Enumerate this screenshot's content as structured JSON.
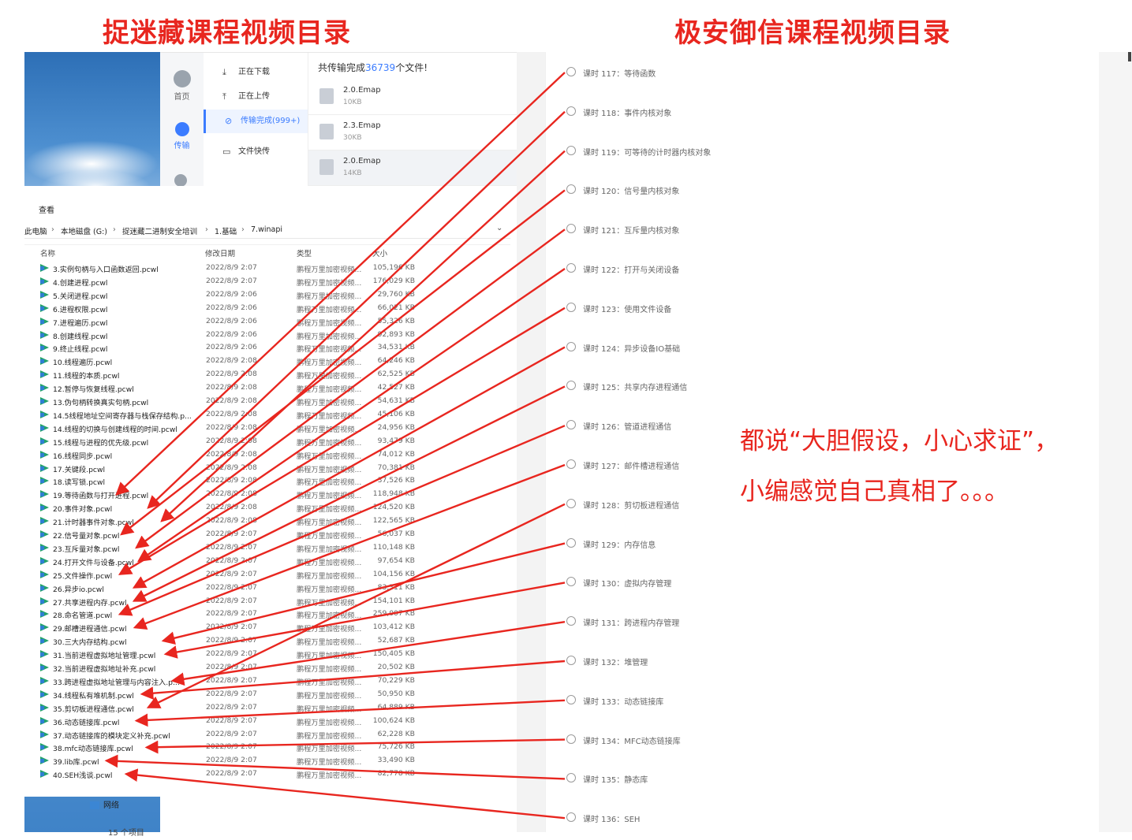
{
  "headings": {
    "left": "捉迷藏课程视频目录",
    "right": "极安御信课程视频目录"
  },
  "netdisk": {
    "nav": [
      {
        "label": "首页",
        "icon": "cloud-icon"
      },
      {
        "label": "传输",
        "icon": "transfer-icon"
      }
    ],
    "menu": [
      {
        "label": "正在下载",
        "icon": "download-icon"
      },
      {
        "label": "正在上传",
        "icon": "upload-icon"
      },
      {
        "label": "传输完成(999+)",
        "icon": "check-circle-icon"
      },
      {
        "label": "文件快传",
        "icon": "monitor-icon"
      }
    ],
    "status_prefix": "共传输完成",
    "status_count": "36739",
    "status_suffix": "个文件!",
    "files": [
      {
        "name": "2.0.Emap",
        "size": "10KB"
      },
      {
        "name": "2.3.Emap",
        "size": "30KB"
      },
      {
        "name": "2.0.Emap",
        "size": "14KB"
      }
    ]
  },
  "explorer": {
    "menu_label": "查看",
    "breadcrumb": [
      "此电脑",
      "本地磁盘 (G:)",
      "捉迷藏二进制安全培训",
      "1.基础",
      "7.winapi"
    ],
    "columns": {
      "name": "名称",
      "date": "修改日期",
      "type": "类型",
      "size": "大小"
    },
    "rows": [
      {
        "name": "3.实例句柄与入口函数返回.pcwl",
        "date": "2022/8/9 2:07",
        "type": "鹏程万里加密视频...",
        "size": "105,196 KB"
      },
      {
        "name": "4.创建进程.pcwl",
        "date": "2022/8/9 2:07",
        "type": "鹏程万里加密视频...",
        "size": "176,029 KB"
      },
      {
        "name": "5.关闭进程.pcwl",
        "date": "2022/8/9 2:06",
        "type": "鹏程万里加密视频...",
        "size": "29,760 KB"
      },
      {
        "name": "6.进程权限.pcwl",
        "date": "2022/8/9 2:06",
        "type": "鹏程万里加密视频...",
        "size": "66,021 KB"
      },
      {
        "name": "7.进程遍历.pcwl",
        "date": "2022/8/9 2:06",
        "type": "鹏程万里加密视频...",
        "size": "55,326 KB"
      },
      {
        "name": "8.创建线程.pcwl",
        "date": "2022/8/9 2:06",
        "type": "鹏程万里加密视频...",
        "size": "92,893 KB"
      },
      {
        "name": "9.终止线程.pcwl",
        "date": "2022/8/9 2:06",
        "type": "鹏程万里加密视频...",
        "size": "34,531 KB"
      },
      {
        "name": "10.线程遍历.pcwl",
        "date": "2022/8/9 2:08",
        "type": "鹏程万里加密视频...",
        "size": "64,246 KB"
      },
      {
        "name": "11.线程的本质.pcwl",
        "date": "2022/8/9 2:08",
        "type": "鹏程万里加密视频...",
        "size": "62,525 KB"
      },
      {
        "name": "12.暂停与恢复线程.pcwl",
        "date": "2022/8/9 2:08",
        "type": "鹏程万里加密视频...",
        "size": "42,527 KB"
      },
      {
        "name": "13.伪句柄转换真实句柄.pcwl",
        "date": "2022/8/9 2:08",
        "type": "鹏程万里加密视频...",
        "size": "54,631 KB"
      },
      {
        "name": "14.5线程地址空间寄存器与栈保存结构.p...",
        "date": "2022/8/9 2:08",
        "type": "鹏程万里加密视频...",
        "size": "45,106 KB"
      },
      {
        "name": "14.线程的切换与创建线程的时间.pcwl",
        "date": "2022/8/9 2:08",
        "type": "鹏程万里加密视频...",
        "size": "24,956 KB"
      },
      {
        "name": "15.线程与进程的优先级.pcwl",
        "date": "2022/8/9 2:08",
        "type": "鹏程万里加密视频...",
        "size": "93,479 KB"
      },
      {
        "name": "16.线程同步.pcwl",
        "date": "2022/8/9 2:08",
        "type": "鹏程万里加密视频...",
        "size": "74,012 KB"
      },
      {
        "name": "17.关键段.pcwl",
        "date": "2022/8/9 2:08",
        "type": "鹏程万里加密视频...",
        "size": "70,381 KB"
      },
      {
        "name": "18.读写锁.pcwl",
        "date": "2022/8/9 2:08",
        "type": "鹏程万里加密视频...",
        "size": "37,526 KB"
      },
      {
        "name": "19.等待函数与打开进程.pcwl",
        "date": "2022/8/9 2:08",
        "type": "鹏程万里加密视频...",
        "size": "118,948 KB"
      },
      {
        "name": "20.事件对象.pcwl",
        "date": "2022/8/9 2:08",
        "type": "鹏程万里加密视频...",
        "size": "124,520 KB"
      },
      {
        "name": "21.计时器事件对象.pcwl",
        "date": "2022/8/9 2:08",
        "type": "鹏程万里加密视频...",
        "size": "122,565 KB"
      },
      {
        "name": "22.信号量对象.pcwl",
        "date": "2022/8/9 2:07",
        "type": "鹏程万里加密视频...",
        "size": "56,037 KB"
      },
      {
        "name": "23.互斥量对象.pcwl",
        "date": "2022/8/9 2:07",
        "type": "鹏程万里加密视频...",
        "size": "110,148 KB"
      },
      {
        "name": "24.打开文件与设备.pcwl",
        "date": "2022/8/9 2:07",
        "type": "鹏程万里加密视频...",
        "size": "97,654 KB"
      },
      {
        "name": "25.文件操作.pcwl",
        "date": "2022/8/9 2:07",
        "type": "鹏程万里加密视频...",
        "size": "104,156 KB"
      },
      {
        "name": "26.异步io.pcwl",
        "date": "2022/8/9 2:07",
        "type": "鹏程万里加密视频...",
        "size": "83,311 KB"
      },
      {
        "name": "27.共享进程内存.pcwl",
        "date": "2022/8/9 2:07",
        "type": "鹏程万里加密视频...",
        "size": "154,101 KB"
      },
      {
        "name": "28.命名管道.pcwl",
        "date": "2022/8/9 2:07",
        "type": "鹏程万里加密视频...",
        "size": "259,007 KB"
      },
      {
        "name": "29.邮槽进程通信.pcwl",
        "date": "2022/8/9 2:07",
        "type": "鹏程万里加密视频...",
        "size": "103,412 KB"
      },
      {
        "name": "30.三大内存结构.pcwl",
        "date": "2022/8/9 2:07",
        "type": "鹏程万里加密视频...",
        "size": "52,687 KB"
      },
      {
        "name": "31.当前进程虚拟地址管理.pcwl",
        "date": "2022/8/9 2:07",
        "type": "鹏程万里加密视频...",
        "size": "150,405 KB"
      },
      {
        "name": "32.当前进程虚拟地址补充.pcwl",
        "date": "2022/8/9 2:07",
        "type": "鹏程万里加密视频...",
        "size": "20,502 KB"
      },
      {
        "name": "33.跨进程虚拟地址管理与内容注入.p...",
        "date": "2022/8/9 2:07",
        "type": "鹏程万里加密视频...",
        "size": "70,229 KB"
      },
      {
        "name": "34.线程私有堆机制.pcwl",
        "date": "2022/8/9 2:07",
        "type": "鹏程万里加密视频...",
        "size": "50,950 KB"
      },
      {
        "name": "35.剪切板进程通信.pcwl",
        "date": "2022/8/9 2:07",
        "type": "鹏程万里加密视频...",
        "size": "64,889 KB"
      },
      {
        "name": "36.动态链接库.pcwl",
        "date": "2022/8/9 2:07",
        "type": "鹏程万里加密视频...",
        "size": "100,624 KB"
      },
      {
        "name": "37.动态链接库的模块定义补充.pcwl",
        "date": "2022/8/9 2:07",
        "type": "鹏程万里加密视频...",
        "size": "62,228 KB"
      },
      {
        "name": "38.mfc动态链接库.pcwl",
        "date": "2022/8/9 2:07",
        "type": "鹏程万里加密视频...",
        "size": "75,726 KB"
      },
      {
        "name": "39.lib库.pcwl",
        "date": "2022/8/9 2:07",
        "type": "鹏程万里加密视频...",
        "size": "33,490 KB"
      },
      {
        "name": "40.SEH浅谈.pcwl",
        "date": "2022/8/9 2:07",
        "type": "鹏程万里加密视频...",
        "size": "82,778 KB"
      }
    ],
    "network_label": "网络",
    "item_count": "15 个项目"
  },
  "course": {
    "lessons": [
      "课时 117：等待函数",
      "课时 118：事件内核对象",
      "课时 119：可等待的计时器内核对象",
      "课时 120：信号量内核对象",
      "课时 121：互斥量内核对象",
      "课时 122：打开与关闭设备",
      "课时 123：使用文件设备",
      "课时 124：异步设备IO基础",
      "课时 125：共享内存进程通信",
      "课时 126：管道进程通信",
      "课时 127：邮件槽进程通信",
      "课时 128：剪切板进程通信",
      "课时 129：内存信息",
      "课时 130：虚拟内存管理",
      "课时 131：跨进程内存管理",
      "课时 132：堆管理",
      "课时 133：动态链接库",
      "课时 134：MFC动态链接库",
      "课时 135：静态库",
      "课时 136：SEH"
    ]
  },
  "comment": {
    "line1": "都说“大胆假设，小心求证”，",
    "line2": "小编感觉自己真相了。。。"
  },
  "colors": {
    "accent_red": "#e8261f",
    "link_blue": "#3b7cff"
  }
}
